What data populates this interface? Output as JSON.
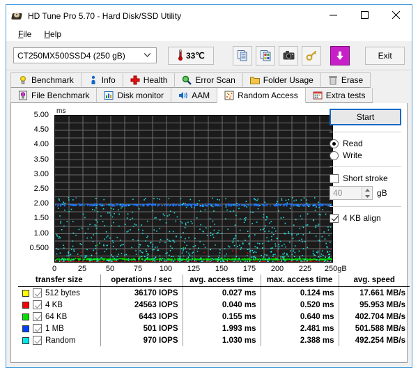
{
  "window": {
    "title": "HD Tune Pro 5.70 - Hard Disk/SSD Utility",
    "app_icon": "hard-disk-icon",
    "minimize": "–",
    "maximize": "□",
    "close": "✕"
  },
  "menu": {
    "items": [
      {
        "label": "File",
        "accel": "F",
        "rest": "ile"
      },
      {
        "label": "Help",
        "accel": "H",
        "rest": "elp"
      }
    ]
  },
  "toolbar": {
    "drive": "CT250MX500SSD4 (250 gB)",
    "temperature": "33℃",
    "buttons": [
      {
        "name": "copy-button",
        "icon": "copy-icon"
      },
      {
        "name": "copy-image-button",
        "icon": "copy-image-icon"
      },
      {
        "name": "screenshot-button",
        "icon": "camera-icon"
      },
      {
        "name": "options-button",
        "icon": "key-icon"
      },
      {
        "name": "save-button",
        "icon": "download-arrow-icon"
      }
    ],
    "exit_label": "Exit"
  },
  "tabs": {
    "row1": [
      {
        "label": "Benchmark",
        "icon": "lightbulb-icon",
        "active": false
      },
      {
        "label": "Info",
        "icon": "info-person-icon",
        "active": false
      },
      {
        "label": "Health",
        "icon": "red-cross-icon",
        "active": false
      },
      {
        "label": "Error Scan",
        "icon": "magnifier-icon",
        "active": false
      },
      {
        "label": "Folder Usage",
        "icon": "folder-icon",
        "active": false
      },
      {
        "label": "Erase",
        "icon": "trash-icon",
        "active": false
      }
    ],
    "row2": [
      {
        "label": "File Benchmark",
        "icon": "file-benchmark-icon",
        "active": false
      },
      {
        "label": "Disk monitor",
        "icon": "bar-chart-icon",
        "active": false
      },
      {
        "label": "AAM",
        "icon": "speaker-icon",
        "active": false
      },
      {
        "label": "Random Access",
        "icon": "scatter-icon",
        "active": true
      },
      {
        "label": "Extra tests",
        "icon": "extra-tests-icon",
        "active": false
      }
    ]
  },
  "controls": {
    "start_label": "Start",
    "mode_read": "Read",
    "mode_write": "Write",
    "mode_selected": "Read",
    "short_stroke_label": "Short stroke",
    "short_stroke_checked": false,
    "short_stroke_value": "40",
    "short_stroke_unit": "gB",
    "align_label": "4 KB align",
    "align_checked": true
  },
  "chart_data": {
    "type": "scatter",
    "title": "",
    "xlabel": "gB",
    "ylabel": "ms",
    "y_unit": "ms",
    "x_unit": "gB",
    "xlim": [
      0,
      250
    ],
    "ylim": [
      0,
      5.0
    ],
    "grid": true,
    "background": "#1b1b1b",
    "gridline_color": "#6e6e6e",
    "x_ticks": [
      "0",
      "25",
      "50",
      "75",
      "100",
      "125",
      "150",
      "175",
      "200",
      "225",
      "250"
    ],
    "x_tick_values": [
      0,
      25,
      50,
      75,
      100,
      125,
      150,
      175,
      200,
      225,
      250
    ],
    "x_last_suffix": "gB",
    "y_ticks": [
      "0.500",
      "1.00",
      "1.50",
      "2.00",
      "2.50",
      "3.00",
      "3.50",
      "4.00",
      "4.50",
      "5.00"
    ],
    "y_tick_values": [
      0.5,
      1.0,
      1.5,
      2.0,
      2.5,
      3.0,
      3.5,
      4.0,
      4.5,
      5.0
    ],
    "series": [
      {
        "name": "512 bytes",
        "color": "#ffff00",
        "mean_ms": 0.027,
        "max_ms": 0.124,
        "density": 230,
        "spread": 0.06,
        "style": "band"
      },
      {
        "name": "4 KB",
        "color": "#ff0000",
        "mean_ms": 0.04,
        "max_ms": 0.52,
        "density": 900,
        "spread": 0.05,
        "style": "band"
      },
      {
        "name": "64 KB",
        "color": "#00e000",
        "mean_ms": 0.155,
        "max_ms": 0.64,
        "density": 600,
        "spread": 0.05,
        "style": "band"
      },
      {
        "name": "1 MB",
        "color": "#1e78ff",
        "mean_ms": 1.993,
        "max_ms": 2.481,
        "density": 480,
        "spread": 0.07,
        "style": "band"
      },
      {
        "name": "Random",
        "color": "#22e0e0",
        "mean_ms": 1.03,
        "max_ms": 2.388,
        "density": 700,
        "spread": 0.62,
        "style": "cloud"
      }
    ]
  },
  "results": {
    "columns": [
      "transfer size",
      "operations / sec",
      "avg. access time",
      "max. access time",
      "avg. speed"
    ],
    "rows": [
      {
        "color": "#ffff00",
        "checked": true,
        "transfer_size": "512 bytes",
        "ops": "36170 IOPS",
        "avg_access": "0.027 ms",
        "max_access": "0.124 ms",
        "avg_speed": "17.661 MB/s"
      },
      {
        "color": "#ff0000",
        "checked": true,
        "transfer_size": "4 KB",
        "ops": "24563 IOPS",
        "avg_access": "0.040 ms",
        "max_access": "0.520 ms",
        "avg_speed": "95.953 MB/s"
      },
      {
        "color": "#00e000",
        "checked": true,
        "transfer_size": "64 KB",
        "ops": "6443 IOPS",
        "avg_access": "0.155 ms",
        "max_access": "0.640 ms",
        "avg_speed": "402.704 MB/s"
      },
      {
        "color": "#0040ff",
        "checked": true,
        "transfer_size": "1 MB",
        "ops": "501 IOPS",
        "avg_access": "1.993 ms",
        "max_access": "2.481 ms",
        "avg_speed": "501.588 MB/s"
      },
      {
        "color": "#00e8e8",
        "checked": true,
        "transfer_size": "Random",
        "ops": "970 IOPS",
        "avg_access": "1.030 ms",
        "max_access": "2.388 ms",
        "avg_speed": "492.254 MB/s"
      }
    ]
  }
}
